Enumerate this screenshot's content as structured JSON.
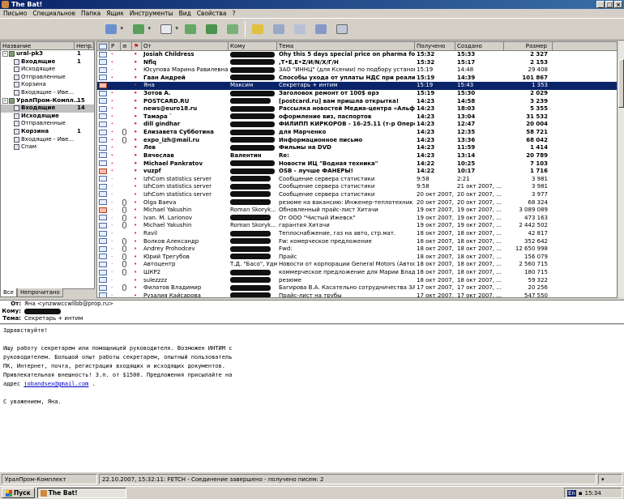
{
  "window": {
    "title": "The Bat!"
  },
  "menu": [
    "Письмо",
    "Специальное",
    "Папка",
    "Ящик",
    "Инструменты",
    "Вид",
    "Свойства",
    "?"
  ],
  "toolbar_icons": [
    "get-mail-icon",
    "send-mail-icon",
    "new-message-icon",
    "reply-icon",
    "reply-all-icon",
    "forward-icon",
    "address-book-icon",
    "print-icon",
    "delete-icon",
    "copy-icon",
    "move-icon",
    "trash-icon"
  ],
  "folders": {
    "headers": [
      "Название",
      "Непр."
    ],
    "items": [
      {
        "name": "ural-pk3",
        "count": "1",
        "bold": true,
        "expand": "-"
      },
      {
        "name": "Входящие",
        "count": "1",
        "bold": true
      },
      {
        "name": "Исходящие",
        "count": ""
      },
      {
        "name": "Отправленные",
        "count": ""
      },
      {
        "name": "Корзина",
        "count": ""
      },
      {
        "name": "Входящие - Иве...",
        "count": ""
      },
      {
        "name": "УралПром-Компл...",
        "count": "15",
        "bold": true,
        "expand": "-"
      },
      {
        "name": "Входящие",
        "count": "14",
        "bold": true,
        "selected": true
      },
      {
        "name": "Исходящие",
        "count": "",
        "bold": true
      },
      {
        "name": "Отправленные",
        "count": ""
      },
      {
        "name": "Корзина",
        "count": "1",
        "bold": true
      },
      {
        "name": "Входящие - Иве...",
        "count": ""
      },
      {
        "name": "Спам",
        "count": ""
      }
    ],
    "tabs": [
      "Все",
      "Непрочитано"
    ]
  },
  "columns": [
    "От",
    "Кому",
    "Тема",
    "Получено",
    "Создано",
    "Размер"
  ],
  "messages": [
    {
      "from": "Josiah Childress",
      "to": "",
      "subj": "Ohy this 5 days special price on pharma for yo...",
      "rec": "15:32",
      "cre": "15:33",
      "size": "2 327",
      "unread": true,
      "bw": 55
    },
    {
      "from": "Nflq",
      "to": "",
      "subj": ",T•E,E•Z/И/N/X/Г/Н",
      "rec": "15:32",
      "cre": "15:17",
      "size": "2 153",
      "unread": true,
      "bw": 55
    },
    {
      "from": "Юсупова Марина Равилевна",
      "to": "",
      "subj": "ЗАО \"ИННЦ\" (для Ксении) по подбору установок.",
      "rec": "15:19",
      "cre": "14:48",
      "size": "29 408",
      "bw": 55
    },
    {
      "from": "Гаан Андрей",
      "to": "",
      "subj": "Способы ухода от уплаты НДС при реализац...",
      "rec": "15:19",
      "cre": "14:39",
      "size": "101 867",
      "unread": true,
      "bw": 55
    },
    {
      "from": "Яна",
      "to": "Максим",
      "subj": "Секретарь + интим",
      "rec": "15:19",
      "cre": "15:43",
      "size": "1 353",
      "selected": true,
      "red": true
    },
    {
      "from": "Зотов А.",
      "to": "",
      "subj": "Заголовок ремонт от 100$ ɞрэ",
      "rec": "15:19",
      "cre": "15:30",
      "size": "2 029",
      "unread": true,
      "bw": 55
    },
    {
      "from": "POSTCARD.RU",
      "to": "",
      "subj": "[postcard.ru] вам пришла открытка!",
      "rec": "14:23",
      "cre": "14:58",
      "size": "3 239",
      "unread": true,
      "bw": 50
    },
    {
      "from": "news@euro18.ru",
      "to": "",
      "subj": "Рассылка новостей Медиа-центра «Альфа Р...",
      "rec": "14:23",
      "cre": "18:03",
      "size": "5 355",
      "unread": true,
      "bw": 55
    },
    {
      "from": "Тамара `",
      "to": "",
      "subj": "оформление виз, паспортов",
      "rec": "14:23",
      "cre": "13:04",
      "size": "31 532",
      "unread": true,
      "bw": 55
    },
    {
      "from": "dill gindhar",
      "to": "",
      "subj": "ФИЛИПП КИРКОРОВ - 16-25.11 (т-р Опереттт...",
      "rec": "14:23",
      "cre": "12:47",
      "size": "20 004",
      "unread": true,
      "bw": 55
    },
    {
      "from": "Елизавета Субботина",
      "to": "",
      "subj": "для Марченко",
      "rec": "14:23",
      "cre": "12:35",
      "size": "58 721",
      "unread": true,
      "bw": 55,
      "clip": true
    },
    {
      "from": "expo_izh@mail.ru",
      "to": "",
      "subj": "Информационное письмо",
      "rec": "14:23",
      "cre": "13:36",
      "size": "68 042",
      "unread": true,
      "bw": 55,
      "clip": true
    },
    {
      "from": "Лев",
      "to": "",
      "subj": "Фильмы на DVD",
      "rec": "14:23",
      "cre": "11:59",
      "size": "1 414",
      "unread": true,
      "bw": 55
    },
    {
      "from": "Вячеслав",
      "to": "Валентин",
      "subj": "Re:",
      "rec": "14:23",
      "cre": "13:14",
      "size": "20 789",
      "unread": true
    },
    {
      "from": "Michael Pankratov",
      "to": "",
      "subj": "Новости ИЦ \"Водная техника\"",
      "rec": "14:22",
      "cre": "10:25",
      "size": "7 103",
      "unread": true,
      "bw": 55
    },
    {
      "from": "vuzpf",
      "to": "",
      "subj": "OSB - лучше ФАНЕРЫ!",
      "rec": "14:22",
      "cre": "10:17",
      "size": "1 716",
      "unread": true,
      "bw": 55,
      "red": true
    },
    {
      "from": "IzhCom statistics server",
      "to": "",
      "subj": "Сообщение сервера статистики",
      "rec": "9:58",
      "cre": "2:21",
      "size": "3 981",
      "bw": 50
    },
    {
      "from": "IzhCom statistics server",
      "to": "",
      "subj": "Сообщение сервера статистики",
      "rec": "9:58",
      "cre": "21 окт 2007, ...",
      "size": "3 981",
      "bw": 50
    },
    {
      "from": "IzhCom statistics server",
      "to": "",
      "subj": "Сообщение сервера статистики",
      "rec": "20 окт 2007, ...",
      "cre": "20 окт 2007, ...",
      "size": "3 977",
      "bw": 50
    },
    {
      "from": "Olga Baeva",
      "to": "",
      "subj": "резюме на вакансию: Инженер-теплотехник",
      "rec": "20 окт 2007, ...",
      "cre": "20 окт 2007, ...",
      "size": "68 324",
      "bw": 50,
      "clip": true
    },
    {
      "from": "Michael Yakushin",
      "to": "Roman Skoryk...",
      "subj": "Обновленный прайс-лист Хитачи",
      "rec": "19 окт 2007, ...",
      "cre": "19 окт 2007, ...",
      "size": "3 089 089",
      "clip": true,
      "red": true
    },
    {
      "from": "Ivan. M. Larionov",
      "to": "",
      "subj": "От ООО \"Чистый Ижевск\"",
      "rec": "19 окт 2007, ...",
      "cre": "19 окт 2007, ...",
      "size": "473 163",
      "bw": 50,
      "clip": true
    },
    {
      "from": "Michael Yakushin",
      "to": "Roman Skoryk...",
      "subj": "гарантия Хитачи",
      "rec": "19 окт 2007, ...",
      "cre": "19 окт 2007, ...",
      "size": "2 442 502",
      "clip": true
    },
    {
      "from": "Ravil",
      "to": "",
      "subj": "Теплоснабжение, газ на авто, стр.мат.",
      "rec": "18 окт 2007, ...",
      "cre": "18 окт 2007, ...",
      "size": "42 817",
      "bw": 50
    },
    {
      "from": "Волков Александр",
      "to": "",
      "subj": "Fw: комерческое предложение",
      "rec": "18 окт 2007, ...",
      "cre": "18 окт 2007, ...",
      "size": "352 642",
      "bw": 50,
      "clip": true
    },
    {
      "from": "Andrey Prohodcev",
      "to": "",
      "subj": "Fwd:",
      "rec": "18 окт 2007, ...",
      "cre": "18 окт 2007, ...",
      "size": "12 650 998",
      "bw": 50,
      "clip": true
    },
    {
      "from": "Юрий  Трегубов",
      "to": "",
      "subj": "Прайс",
      "rec": "18 окт 2007, ...",
      "cre": "18 окт 2007, ...",
      "size": "156 079",
      "bw": 50,
      "clip": true
    },
    {
      "from": "Автоцентр",
      "to": "Т.Д. \"Басо\", Удмуртия...",
      "subj": "Новости от корпорации General Motors    (Автосалон ...",
      "rec": "18 окт 2007, ...",
      "cre": "18 окт 2007, ...",
      "size": "2 560 715",
      "clip": true
    },
    {
      "from": "ШКР2",
      "to": "",
      "subj": "коммерческое предложение для Марии Владимиров...",
      "rec": "18 окт 2007, ...",
      "cre": "18 окт 2007, ...",
      "size": "180 715",
      "bw": 50,
      "clip": true
    },
    {
      "from": "sulezzzz",
      "to": "",
      "subj": "резюме",
      "rec": "18 окт 2007, ...",
      "cre": "18 окт 2007, ...",
      "size": "59 322",
      "bw": 50
    },
    {
      "from": "Филатов Владимир",
      "to": "",
      "subj": "Багирова В.А. Касательно сотрудничества ЗАО \"СТР...",
      "rec": "17 окт 2007, ...",
      "cre": "17 окт 2007, ...",
      "size": "20 256",
      "bw": 50,
      "clip": true
    },
    {
      "from": "Рузалия Кайсарова",
      "to": "",
      "subj": "Прайс-лист  на трубы",
      "rec": "17 окт 2007, ...",
      "cre": "17 окт 2007, ...",
      "size": "547 550",
      "bw": 50
    }
  ],
  "preview": {
    "from_label": "От:",
    "from": "Яна <ynzwwccwllbb@prop.ru>",
    "to_label": "Кому:",
    "to": "",
    "subj_label": "Тема:",
    "subj": "Секретарь + интим"
  },
  "body": {
    "lines": [
      "Здравствуйте!",
      "",
      "Ищу работу секретарем или помощницей руководителя. Возможен ИНТИМ с",
      "руководителем. Большой опыт работы секретарем, опытный пользователь",
      "ПК, Интернет, почта, регистрация входящих и исходящих документов.",
      "Привлекательная внешность! З.п. от $1500. Предложения присылайте на"
    ],
    "addr_prefix": "адрес ",
    "addr": "jobandsex@gmail.com",
    "addr_suffix": " .",
    "closing": [
      "",
      "С уважением, Яна."
    ]
  },
  "status": {
    "account": "УралПром-Комплект",
    "log": "22.10.2007, 15:32:11: FETCH - Соединение завершено - получено писем: 2"
  },
  "taskbar": {
    "start": "Пуск",
    "app": "The Bat!",
    "lang": "En",
    "time": "15:34"
  }
}
